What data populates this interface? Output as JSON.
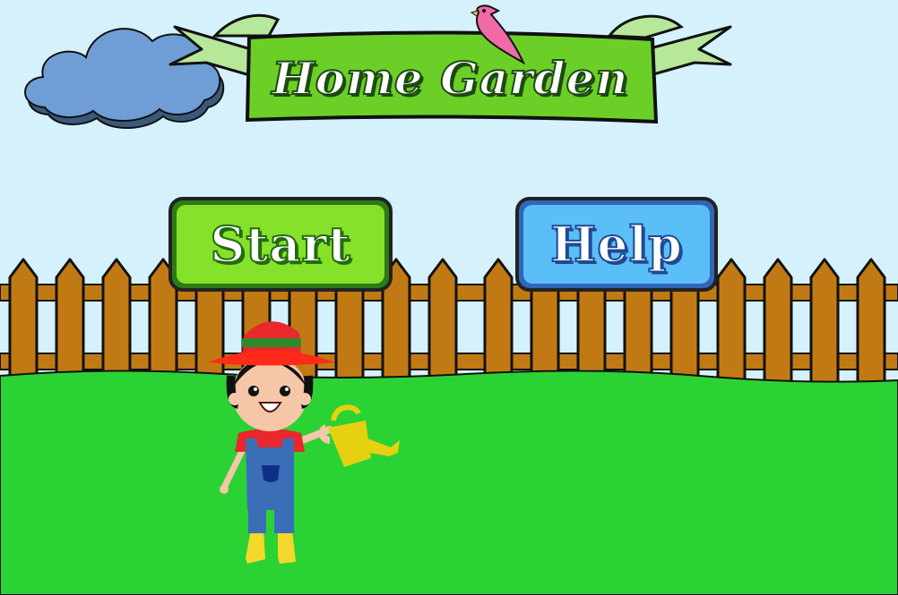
{
  "game": {
    "title": "Home Garden",
    "buttons": {
      "start_label": "Start",
      "help_label": "Help"
    }
  },
  "colors": {
    "sky": "#d5f1fc",
    "grass": "#2bd234",
    "fence": "#c17a13",
    "banner": "#6ccf27",
    "cloud": "#6f9ed6",
    "bird": "#f06aa8",
    "start_button": "#86e12a",
    "help_button": "#5bbef7"
  },
  "icons": [
    "cloud-icon",
    "bird-icon",
    "gardener-icon",
    "watering-can-icon"
  ]
}
